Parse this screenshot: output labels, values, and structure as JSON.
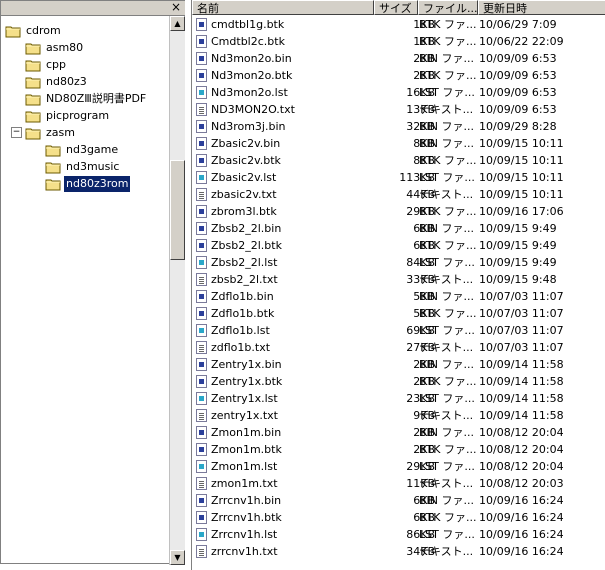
{
  "tree": {
    "close_glyph": "×",
    "items": [
      {
        "label": "cdrom",
        "expanded": true
      },
      {
        "label": "asm80"
      },
      {
        "label": "cpp"
      },
      {
        "label": "nd80z3"
      },
      {
        "label": "ND80ZⅢ説明書PDF"
      },
      {
        "label": "picprogram"
      },
      {
        "label": "zasm",
        "expanded": true,
        "toggle": "−"
      },
      {
        "label": "nd3game"
      },
      {
        "label": "nd3music"
      },
      {
        "label": "nd80z3rom",
        "selected": true
      }
    ]
  },
  "list": {
    "columns": [
      "名前",
      "サイズ",
      "ファイル...",
      "更新日時"
    ],
    "rows": [
      {
        "name": "cmdtbl1g.btk",
        "size": "1KB",
        "type": "BTK ファ...",
        "date": "10/06/29 7:09",
        "icon": "bin"
      },
      {
        "name": "Cmdtbl2c.btk",
        "size": "1KB",
        "type": "BTK ファ...",
        "date": "10/06/22 22:09",
        "icon": "bin"
      },
      {
        "name": "Nd3mon2o.bin",
        "size": "2KB",
        "type": "BIN ファ...",
        "date": "10/09/09 6:53",
        "icon": "bin"
      },
      {
        "name": "Nd3mon2o.btk",
        "size": "2KB",
        "type": "BTK ファ...",
        "date": "10/09/09 6:53",
        "icon": "bin"
      },
      {
        "name": "Nd3mon2o.lst",
        "size": "16KB",
        "type": "LST ファ...",
        "date": "10/09/09 6:53",
        "icon": "lst"
      },
      {
        "name": "ND3MON2O.txt",
        "size": "13KB",
        "type": "テキスト...",
        "date": "10/09/09 6:53",
        "icon": "txt"
      },
      {
        "name": "Nd3rom3j.bin",
        "size": "32KB",
        "type": "BIN ファ...",
        "date": "10/09/29 8:28",
        "icon": "bin"
      },
      {
        "name": "Zbasic2v.bin",
        "size": "8KB",
        "type": "BIN ファ...",
        "date": "10/09/15 10:11",
        "icon": "bin"
      },
      {
        "name": "Zbasic2v.btk",
        "size": "8KB",
        "type": "BTK ファ...",
        "date": "10/09/15 10:11",
        "icon": "bin"
      },
      {
        "name": "Zbasic2v.lst",
        "size": "113KB",
        "type": "LST ファ...",
        "date": "10/09/15 10:11",
        "icon": "lst"
      },
      {
        "name": "zbasic2v.txt",
        "size": "44KB",
        "type": "テキスト...",
        "date": "10/09/15 10:11",
        "icon": "txt"
      },
      {
        "name": "zbrom3l.btk",
        "size": "29KB",
        "type": "BTK ファ...",
        "date": "10/09/16 17:06",
        "icon": "bin"
      },
      {
        "name": "Zbsb2_2l.bin",
        "size": "6KB",
        "type": "BIN ファ...",
        "date": "10/09/15 9:49",
        "icon": "bin"
      },
      {
        "name": "Zbsb2_2l.btk",
        "size": "6KB",
        "type": "BTK ファ...",
        "date": "10/09/15 9:49",
        "icon": "bin"
      },
      {
        "name": "Zbsb2_2l.lst",
        "size": "84KB",
        "type": "LST ファ...",
        "date": "10/09/15 9:49",
        "icon": "lst"
      },
      {
        "name": "zbsb2_2l.txt",
        "size": "33KB",
        "type": "テキスト...",
        "date": "10/09/15 9:48",
        "icon": "txt"
      },
      {
        "name": "Zdflo1b.bin",
        "size": "5KB",
        "type": "BIN ファ...",
        "date": "10/07/03 11:07",
        "icon": "bin"
      },
      {
        "name": "Zdflo1b.btk",
        "size": "5KB",
        "type": "BTK ファ...",
        "date": "10/07/03 11:07",
        "icon": "bin"
      },
      {
        "name": "Zdflo1b.lst",
        "size": "69KB",
        "type": "LST ファ...",
        "date": "10/07/03 11:07",
        "icon": "lst"
      },
      {
        "name": "zdflo1b.txt",
        "size": "27KB",
        "type": "テキスト...",
        "date": "10/07/03 11:07",
        "icon": "txt"
      },
      {
        "name": "Zentry1x.bin",
        "size": "2KB",
        "type": "BIN ファ...",
        "date": "10/09/14 11:58",
        "icon": "bin"
      },
      {
        "name": "Zentry1x.btk",
        "size": "2KB",
        "type": "BTK ファ...",
        "date": "10/09/14 11:58",
        "icon": "bin"
      },
      {
        "name": "Zentry1x.lst",
        "size": "23KB",
        "type": "LST ファ...",
        "date": "10/09/14 11:58",
        "icon": "lst"
      },
      {
        "name": "zentry1x.txt",
        "size": "9KB",
        "type": "テキスト...",
        "date": "10/09/14 11:58",
        "icon": "txt"
      },
      {
        "name": "Zmon1m.bin",
        "size": "2KB",
        "type": "BIN ファ...",
        "date": "10/08/12 20:04",
        "icon": "bin"
      },
      {
        "name": "Zmon1m.btk",
        "size": "2KB",
        "type": "BTK ファ...",
        "date": "10/08/12 20:04",
        "icon": "bin"
      },
      {
        "name": "Zmon1m.lst",
        "size": "29KB",
        "type": "LST ファ...",
        "date": "10/08/12 20:04",
        "icon": "lst"
      },
      {
        "name": "zmon1m.txt",
        "size": "11KB",
        "type": "テキスト...",
        "date": "10/08/12 20:03",
        "icon": "txt"
      },
      {
        "name": "Zrrcnv1h.bin",
        "size": "6KB",
        "type": "BIN ファ...",
        "date": "10/09/16 16:24",
        "icon": "bin"
      },
      {
        "name": "Zrrcnv1h.btk",
        "size": "6KB",
        "type": "BTK ファ...",
        "date": "10/09/16 16:24",
        "icon": "bin"
      },
      {
        "name": "Zrrcnv1h.lst",
        "size": "86KB",
        "type": "LST ファ...",
        "date": "10/09/16 16:24",
        "icon": "lst"
      },
      {
        "name": "zrrcnv1h.txt",
        "size": "34KB",
        "type": "テキスト...",
        "date": "10/09/16 16:24",
        "icon": "txt"
      }
    ]
  }
}
